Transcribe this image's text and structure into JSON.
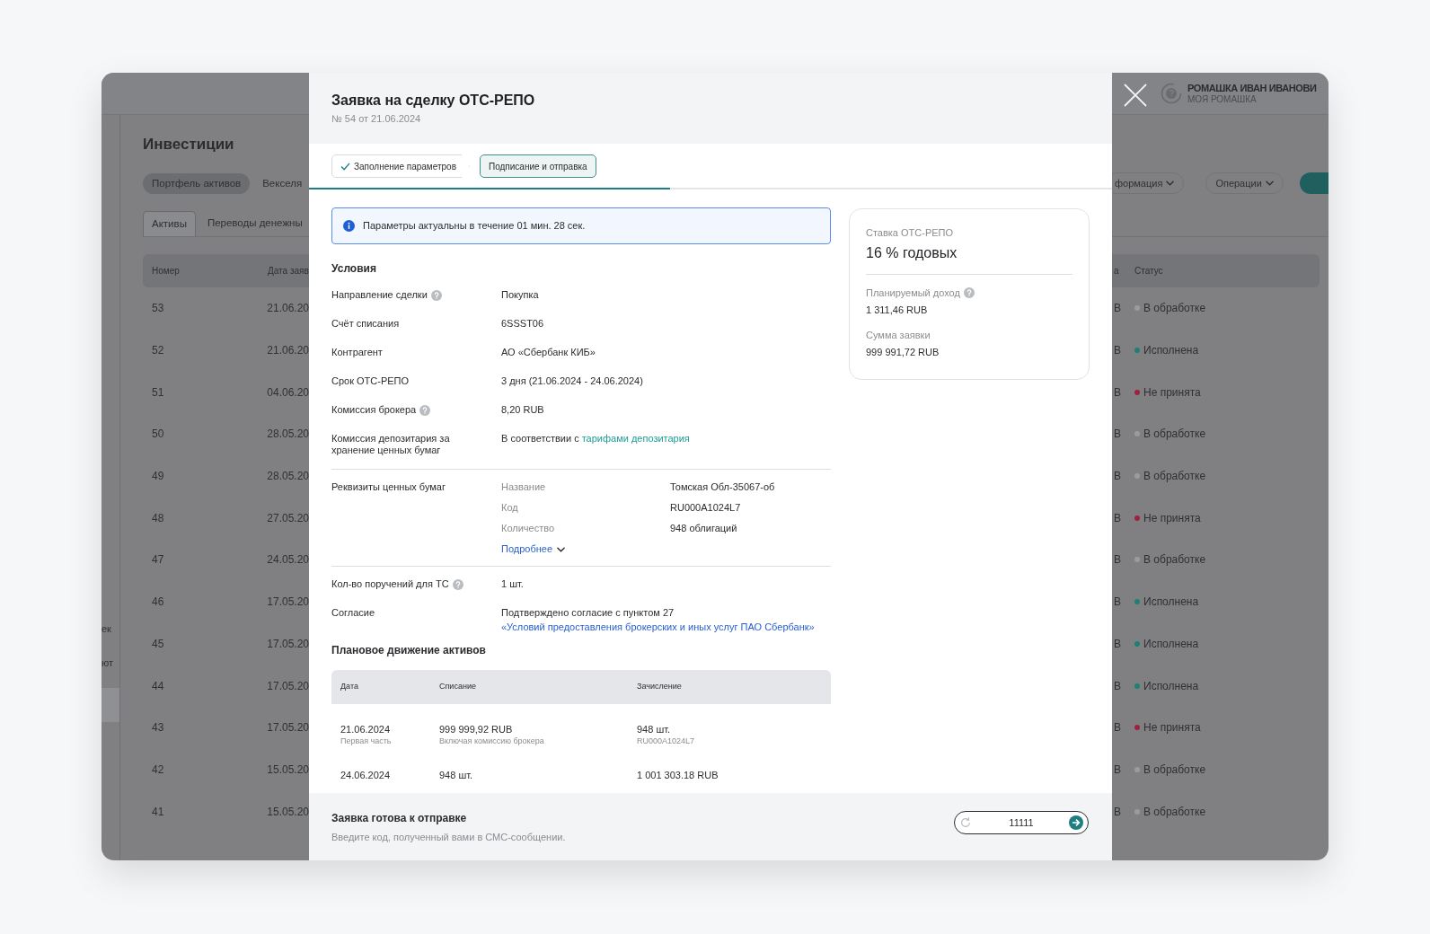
{
  "background": {
    "header": {
      "user_name": "РОМАШКА ИВАН ИВАНОВИ",
      "user_org": "МОЯ РОМАШКА"
    },
    "sidebar_items": [
      {
        "label": "ек",
        "selected": false
      },
      {
        "label": "ют",
        "selected": false
      },
      {
        "selected": true
      }
    ],
    "page_title": "Инвестиции",
    "pills": [
      {
        "label": "Портфель активов",
        "selected": true
      },
      {
        "label": "Векселя",
        "selected": false
      }
    ],
    "right_buttons": [
      {
        "label": "формация",
        "kind": "dropdown"
      },
      {
        "label": "Операции",
        "kind": "dropdown"
      },
      {
        "kind": "primary"
      }
    ],
    "tabs": [
      {
        "label": "Активы",
        "selected": true
      },
      {
        "label": "Переводы денежны",
        "selected": false
      }
    ],
    "table": {
      "columns_left": [
        "Номер",
        "Дата заяв"
      ],
      "columns_right": [
        "а",
        "Статус"
      ],
      "rows": [
        {
          "number": "53",
          "date": "21.06.20",
          "amount_tail": "B",
          "status": "В обработке",
          "color": "#9a9b9e"
        },
        {
          "number": "52",
          "date": "21.06.20",
          "amount_tail": "B",
          "status": "Исполнена",
          "color": "#1d7f76"
        },
        {
          "number": "51",
          "date": "04.06.20",
          "amount_tail": "B",
          "status": "Не принята",
          "color": "#a0203f"
        },
        {
          "number": "50",
          "date": "28.05.20",
          "amount_tail": "B",
          "status": "В обработке",
          "color": "#9a9b9e"
        },
        {
          "number": "49",
          "date": "28.05.20",
          "amount_tail": "B",
          "status": "В обработке",
          "color": "#9a9b9e"
        },
        {
          "number": "48",
          "date": "27.05.20",
          "amount_tail": "B",
          "status": "Не принята",
          "color": "#a0203f"
        },
        {
          "number": "47",
          "date": "24.05.20",
          "amount_tail": "B",
          "status": "В обработке",
          "color": "#9a9b9e"
        },
        {
          "number": "46",
          "date": "17.05.20",
          "amount_tail": "B",
          "status": "Исполнена",
          "color": "#1d7f76"
        },
        {
          "number": "45",
          "date": "17.05.20",
          "amount_tail": "B",
          "status": "Исполнена",
          "color": "#1d7f76"
        },
        {
          "number": "44",
          "date": "17.05.20",
          "amount_tail": "B",
          "status": "Исполнена",
          "color": "#1d7f76"
        },
        {
          "number": "43",
          "date": "17.05.20",
          "amount_tail": "B",
          "status": "Не принята",
          "color": "#a0203f"
        },
        {
          "number": "42",
          "date": "15.05.20",
          "amount_tail": "B",
          "status": "В обработке",
          "color": "#9a9b9e"
        },
        {
          "number": "41",
          "date": "15.05.20",
          "amount_tail": "B",
          "status": "В обработке",
          "color": "#9a9b9e"
        }
      ]
    }
  },
  "modal": {
    "title": "Заявка на сделку ОТС-РЕПО",
    "subtitle": "№ 54 от 21.06.2024",
    "steps": [
      {
        "label": "Заполнение параметров",
        "done": true,
        "selected": false
      },
      {
        "label": "Подписание и отправка",
        "done": false,
        "selected": true
      }
    ],
    "progress": {
      "level": 0.45
    },
    "notice": "Параметры актуальны в течение 01 мин. 28 сек.",
    "conditions": {
      "title": "Условия",
      "rows": [
        {
          "kind": "text",
          "label": "Направление сделки",
          "help": true,
          "value": "Покупка"
        },
        {
          "kind": "text",
          "label": "Счёт списания",
          "help": false,
          "value": "6SSST06"
        },
        {
          "kind": "text",
          "label": "Контрагент",
          "help": false,
          "value": "АО «Сбербанк КИБ»"
        },
        {
          "kind": "text",
          "label": "Срок ОТС-РЕПО",
          "help": false,
          "value": "3 дня (21.06.2024 - 24.06.2024)"
        },
        {
          "kind": "text",
          "label": "Комиссия брокера",
          "help": true,
          "value": "8,20 RUB"
        },
        {
          "kind": "link_inline",
          "label": "Комиссия депозитария за хранение ценных бумаг",
          "help": false,
          "value": "В соответствии с",
          "link": "тарифами депозитария"
        }
      ]
    },
    "securities": {
      "label": "Реквизиты ценных бумаг",
      "items": [
        {
          "label": "Название",
          "value": "Томская Обл-35067-об"
        },
        {
          "label": "Код",
          "value": "RU000A1024L7"
        },
        {
          "label": "Количество",
          "value": "948 облигаций"
        }
      ],
      "more": "Подробнее",
      "expanded": false
    },
    "extra_rows": [
      {
        "kind": "text",
        "label": "Кол-во поручений для ТС",
        "help": true,
        "value": "1 шт."
      },
      {
        "kind": "link_below",
        "label": "Согласие",
        "help": false,
        "value": "Подтверждено согласие с пунктом 27",
        "link": "«Условий предоставления брокерских и иных услуг ПАО Сбербанк»"
      }
    ],
    "movement": {
      "title": "Плановое движение активов",
      "columns": [
        "Дата",
        "Списание",
        "Зачисление"
      ],
      "rows": [
        [
          {
            "main": "21.06.2024",
            "sub": "Первая часть"
          },
          {
            "main": "999 999,92 RUB",
            "sub": "Включая комиссию брокера"
          },
          {
            "main": "948 шт.",
            "sub": "RU000A1024L7"
          }
        ],
        [
          {
            "main": "24.06.2024"
          },
          {
            "main": "948 шт."
          },
          {
            "main": "1 001 303.18 RUB"
          }
        ]
      ]
    },
    "card": {
      "rate_label": "Ставка ОТС-РЕПО",
      "rate_value": "16 % годовых",
      "items": [
        {
          "label": "Планируемый доход",
          "help": true,
          "value": "1 311,46 RUB"
        },
        {
          "label": "Сумма заявки",
          "help": false,
          "value": "999 991,72 RUB"
        }
      ]
    },
    "footer": {
      "title": "Заявка готова к отправке",
      "hint": "Введите код, полученный вами в СМС-сообщении.",
      "code": "11111"
    }
  }
}
